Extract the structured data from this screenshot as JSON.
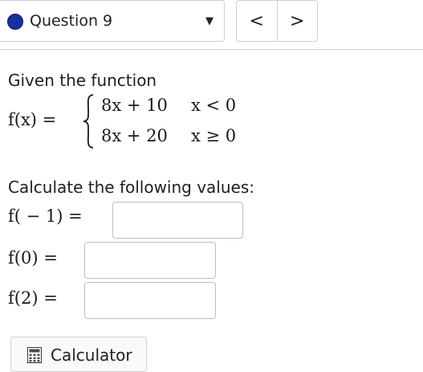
{
  "question_selector": {
    "label": "Question 9",
    "status_color": "#1a2f9c",
    "caret": "▼"
  },
  "navigation": {
    "prev_glyph": "<",
    "next_glyph": ">"
  },
  "problem": {
    "intro": "Given the function",
    "function_lhs": "f(x) =",
    "cases": [
      {
        "expr": "8x + 10",
        "cond": "x < 0"
      },
      {
        "expr": "8x + 20",
        "cond": "x ≥ 0"
      }
    ],
    "prompt": "Calculate the following values:",
    "answers": [
      {
        "label": "f( − 1) =",
        "value": ""
      },
      {
        "label": "f(0) =",
        "value": ""
      },
      {
        "label": "f(2) =",
        "value": ""
      }
    ]
  },
  "tools": {
    "calculator_label": "Calculator",
    "calculator_icon": "calculator-icon"
  }
}
